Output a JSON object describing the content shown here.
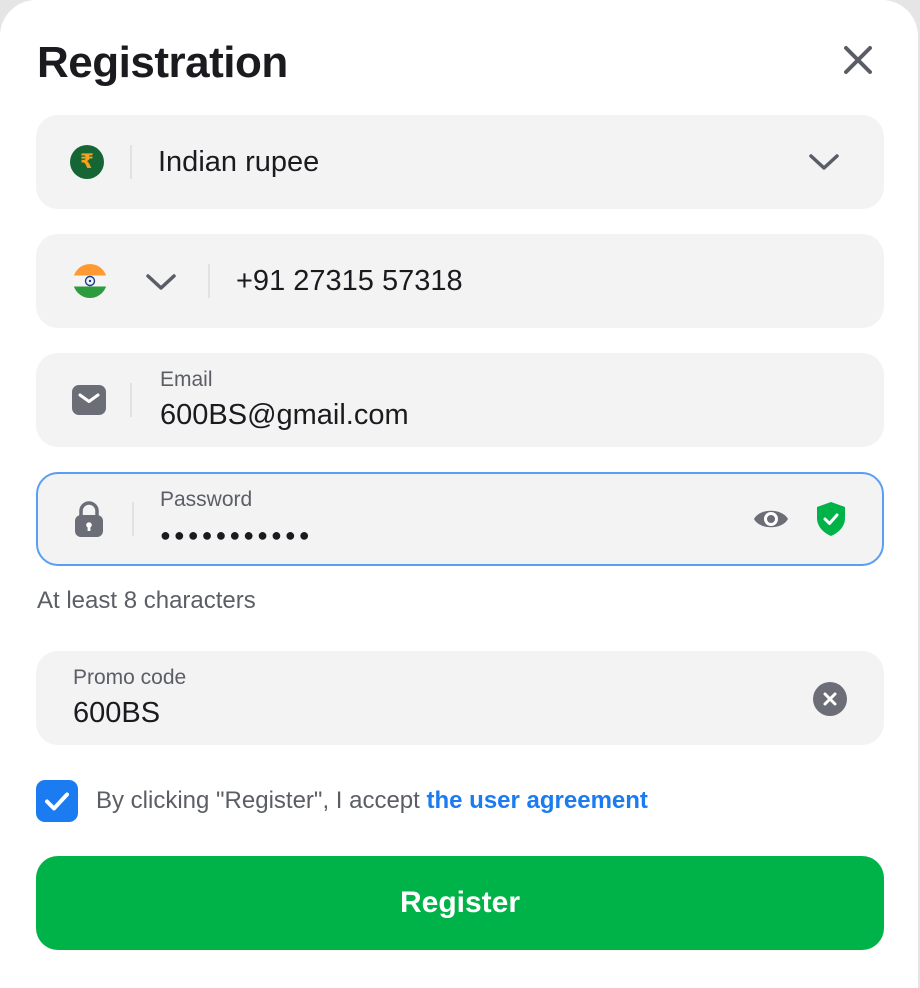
{
  "header": {
    "title": "Registration"
  },
  "currency": {
    "symbol": "₹",
    "value": "Indian rupee"
  },
  "phone": {
    "value": "+91 27315 57318"
  },
  "email": {
    "label": "Email",
    "value": "600BS@gmail.com"
  },
  "password": {
    "label": "Password",
    "value": "●●●●●●●●●●●",
    "hint": "At least 8 characters"
  },
  "promo": {
    "label": "Promo code",
    "value": "600BS"
  },
  "agreement": {
    "checked": true,
    "text": "By clicking \"Register\", I accept ",
    "link_text": "the user agreement"
  },
  "actions": {
    "register_label": "Register"
  },
  "colors": {
    "accent_blue": "#1a7cf0",
    "register_green": "#00b349",
    "field_bg": "#f3f3f4",
    "focus_border": "#5a9ef2"
  },
  "icons": {
    "close": "close-icon",
    "currency": "rupee-icon",
    "currency_dropdown": "chevron-down-icon",
    "flag": "india-flag-icon",
    "country_dropdown": "chevron-down-icon",
    "email": "envelope-icon",
    "password": "lock-icon",
    "show_password": "eye-icon",
    "password_valid": "shield-check-icon",
    "clear_promo": "clear-icon",
    "checkbox": "check-icon"
  }
}
